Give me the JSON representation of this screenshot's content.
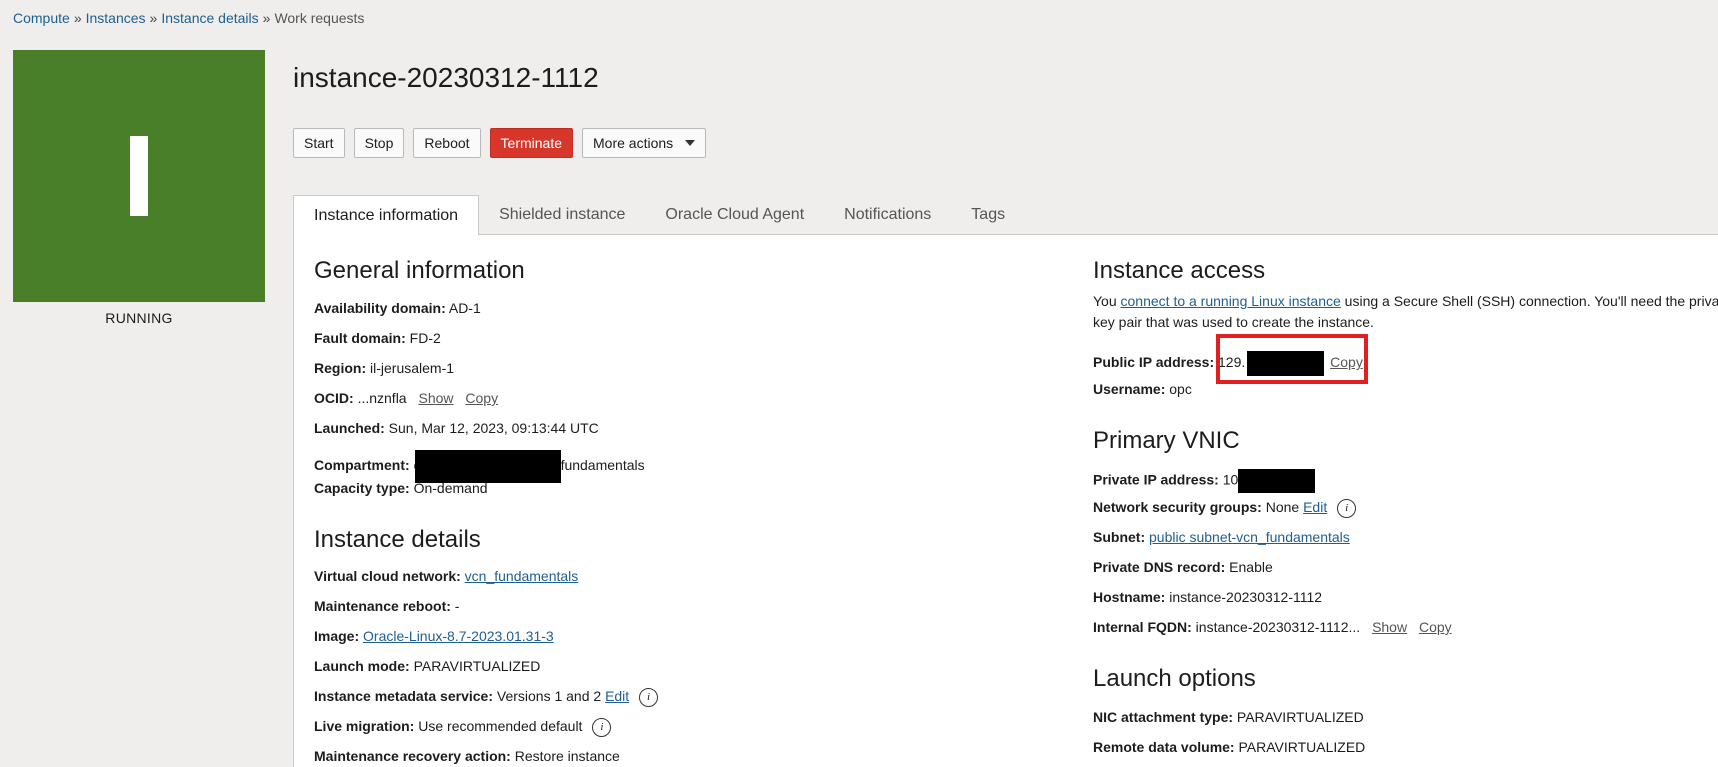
{
  "breadcrumb": {
    "items": [
      "Compute",
      "Instances",
      "Instance details"
    ],
    "current": "Work requests",
    "sep": "»"
  },
  "avatar": {
    "letter": "I",
    "color": "#4a7f2a"
  },
  "state": "RUNNING",
  "title": "instance-20230312-1112",
  "actions": {
    "start": "Start",
    "stop": "Stop",
    "reboot": "Reboot",
    "terminate": "Terminate",
    "more": "More actions"
  },
  "tabs": [
    "Instance information",
    "Shielded instance",
    "Oracle Cloud Agent",
    "Notifications",
    "Tags"
  ],
  "general": {
    "title": "General information",
    "availability_label": "Availability domain:",
    "availability": "AD-1",
    "fault_label": "Fault domain:",
    "fault": "FD-2",
    "region_label": "Region:",
    "region": "il-jerusalem-1",
    "ocid_label": "OCID:",
    "ocid": "...nznfla",
    "show": "Show",
    "copy": "Copy",
    "launched_label": "Launched:",
    "launched": "Sun, Mar 12, 2023, 09:13:44 UTC",
    "compartment_label": "Compartment:",
    "compartment_prefix": "c",
    "compartment_suffix": "fundamentals",
    "capacity_label": "Capacity type:",
    "capacity": "On-demand"
  },
  "details": {
    "title": "Instance details",
    "vcn_label": "Virtual cloud network:",
    "vcn": "vcn_fundamentals",
    "reboot_label": "Maintenance reboot:",
    "reboot": "-",
    "image_label": "Image:",
    "image": "Oracle-Linux-8.7-2023.01.31-3",
    "launch_mode_label": "Launch mode:",
    "launch_mode": "PARAVIRTUALIZED",
    "metadata_label": "Instance metadata service:",
    "metadata": "Versions 1 and 2",
    "edit": "Edit",
    "migration_label": "Live migration:",
    "migration": "Use recommended default",
    "recovery_label": "Maintenance recovery action:",
    "recovery": "Restore instance"
  },
  "access": {
    "title": "Instance access",
    "text_before": "You ",
    "link": "connect to a running Linux instance",
    "text_after": " using a Secure Shell (SSH) connection. You'll need the priva",
    "text_line2": "key pair that was used to create the instance.",
    "ip_label": "Public IP address:",
    "ip_prefix": "129.",
    "copy": "Copy",
    "user_label": "Username:",
    "user": "opc"
  },
  "vnic": {
    "title": "Primary VNIC",
    "private_ip_label": "Private IP address:",
    "private_ip_prefix": "10",
    "nsg_label": "Network security groups:",
    "nsg": "None",
    "edit": "Edit",
    "subnet_label": "Subnet:",
    "subnet": "public subnet-vcn_fundamentals",
    "dns_label": "Private DNS record:",
    "dns": "Enable",
    "hostname_label": "Hostname:",
    "hostname": "instance-20230312-1112",
    "fqdn_label": "Internal FQDN:",
    "fqdn": "instance-20230312-1112...",
    "show": "Show",
    "copy": "Copy"
  },
  "launch": {
    "title": "Launch options",
    "nic_label": "NIC attachment type:",
    "nic": "PARAVIRTUALIZED",
    "remote_label": "Remote data volume:",
    "remote": "PARAVIRTUALIZED"
  },
  "info_icon": "i"
}
